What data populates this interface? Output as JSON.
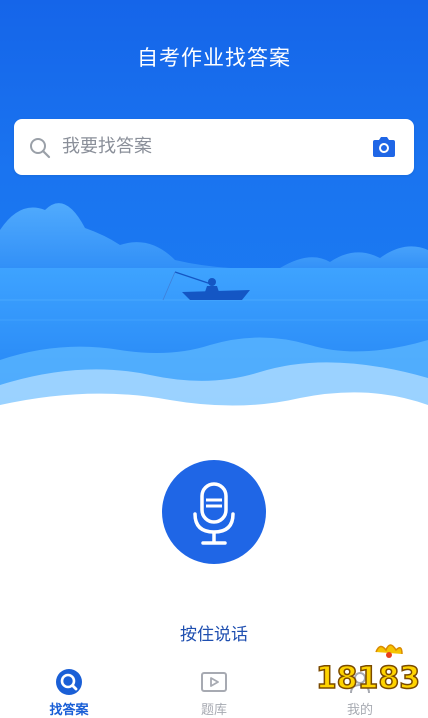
{
  "header": {
    "title": "自考作业找答案"
  },
  "search": {
    "placeholder": "我要找答案"
  },
  "voice": {
    "hint": "按住说话"
  },
  "tabs": [
    {
      "label": "找答案",
      "icon": "search-icon",
      "active": true
    },
    {
      "label": "题库",
      "icon": "play-board-icon",
      "active": false
    },
    {
      "label": "我的",
      "icon": "user-icon",
      "active": false
    }
  ],
  "watermark": {
    "text": "18183"
  },
  "colors": {
    "primary": "#1f66e6",
    "hint": "#1f4fb0",
    "tab_active": "#1a5fd6",
    "tab_inactive": "#a7aab2"
  }
}
